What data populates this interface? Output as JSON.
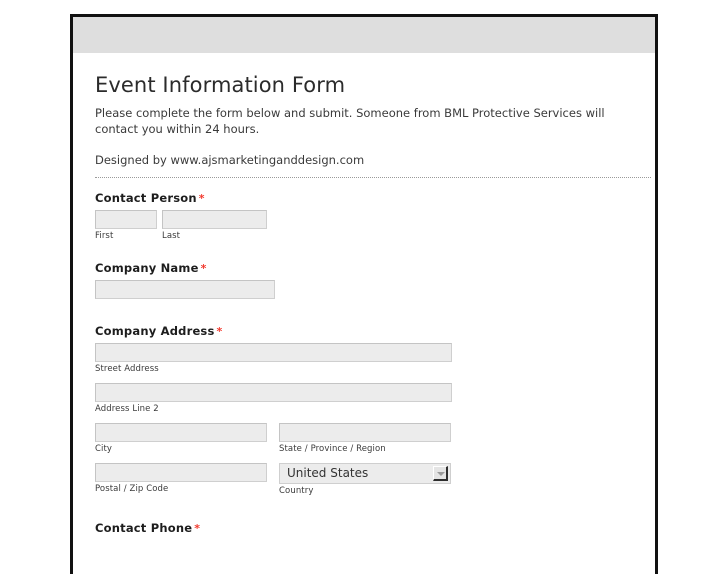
{
  "page": {
    "title": "Event Information Form",
    "intro": "Please complete the form below and submit. Someone from BML Protective Services will contact you within 24 hours.",
    "credit": "Designed by www.ajsmarketinganddesign.com",
    "required_marker": "*",
    "accent_required_color": "#f23a2e",
    "header_band_color": "#dedede",
    "input_fill_color": "#ececec",
    "frame_border_color": "#111111"
  },
  "fields": {
    "contact_person": {
      "label": "Contact Person",
      "required": true,
      "first": {
        "value": "",
        "sub_label": "First"
      },
      "last": {
        "value": "",
        "sub_label": "Last"
      }
    },
    "company_name": {
      "label": "Company Name",
      "required": true,
      "value": ""
    },
    "company_address": {
      "label": "Company Address",
      "required": true,
      "street": {
        "value": "",
        "sub_label": "Street Address"
      },
      "line2": {
        "value": "",
        "sub_label": "Address Line 2"
      },
      "city": {
        "value": "",
        "sub_label": "City"
      },
      "state": {
        "value": "",
        "sub_label": "State / Province / Region"
      },
      "postal": {
        "value": "",
        "sub_label": "Postal / Zip Code"
      },
      "country": {
        "selected": "United States",
        "sub_label": "Country",
        "options": [
          "United States"
        ]
      }
    },
    "contact_phone": {
      "label": "Contact Phone",
      "required": true
    }
  }
}
